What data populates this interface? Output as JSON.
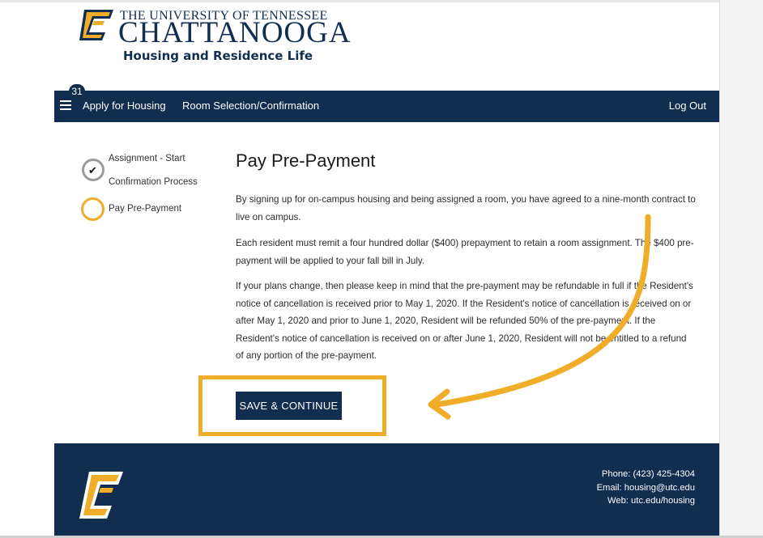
{
  "header": {
    "university_line": "THE UNIVERSITY OF TENNESSEE",
    "campus_name": "CHATTANOOGA",
    "department": "Housing and Residence Life"
  },
  "nav": {
    "badge": "31",
    "items": [
      "Apply for Housing",
      "Room Selection/Confirmation"
    ],
    "logout": "Log Out"
  },
  "steps": [
    {
      "label": "Assignment - Start",
      "state": "completed"
    },
    {
      "label": "Confirmation Process",
      "state": "completed"
    },
    {
      "label": "Pay Pre-Payment",
      "state": "current"
    }
  ],
  "main": {
    "title": "Pay Pre-Payment",
    "paragraphs": [
      "By signing up for on-campus housing and being assigned a room, you have agreed to a nine-month contract to live on campus.",
      "Each resident must remit a four hundred dollar ($400) prepayment to retain a room assignment. The $400 pre-payment will be applied to your fall bill in July.",
      "If your plans change, then please keep in mind that the pre-payment may be refundable in full if the Resident's notice of cancellation is received prior to May 1, 2020. If the Resident's notice of cancellation is received on or after May 1, 2020 and prior to June 1, 2020, Resident will be refunded 50% of the pre-payment. If the Resident's notice of cancellation is received on or after June 1, 2020, Resident will not be entitled to a refund of any portion of the pre-payment."
    ],
    "save_button": "SAVE & CONTINUE"
  },
  "footer": {
    "phone": "Phone: (423) 425-4304",
    "email": "Email: housing@utc.edu",
    "web": "Web: utc.edu/housing"
  },
  "colors": {
    "navy": "#112e51",
    "gold": "#f0ad29",
    "check_gray": "#9a9a9a"
  },
  "icons": {
    "menu": "hamburger-icon",
    "step_done": "check-circle-icon",
    "step_current": "open-circle-icon",
    "logo": "utc-c-logo"
  }
}
